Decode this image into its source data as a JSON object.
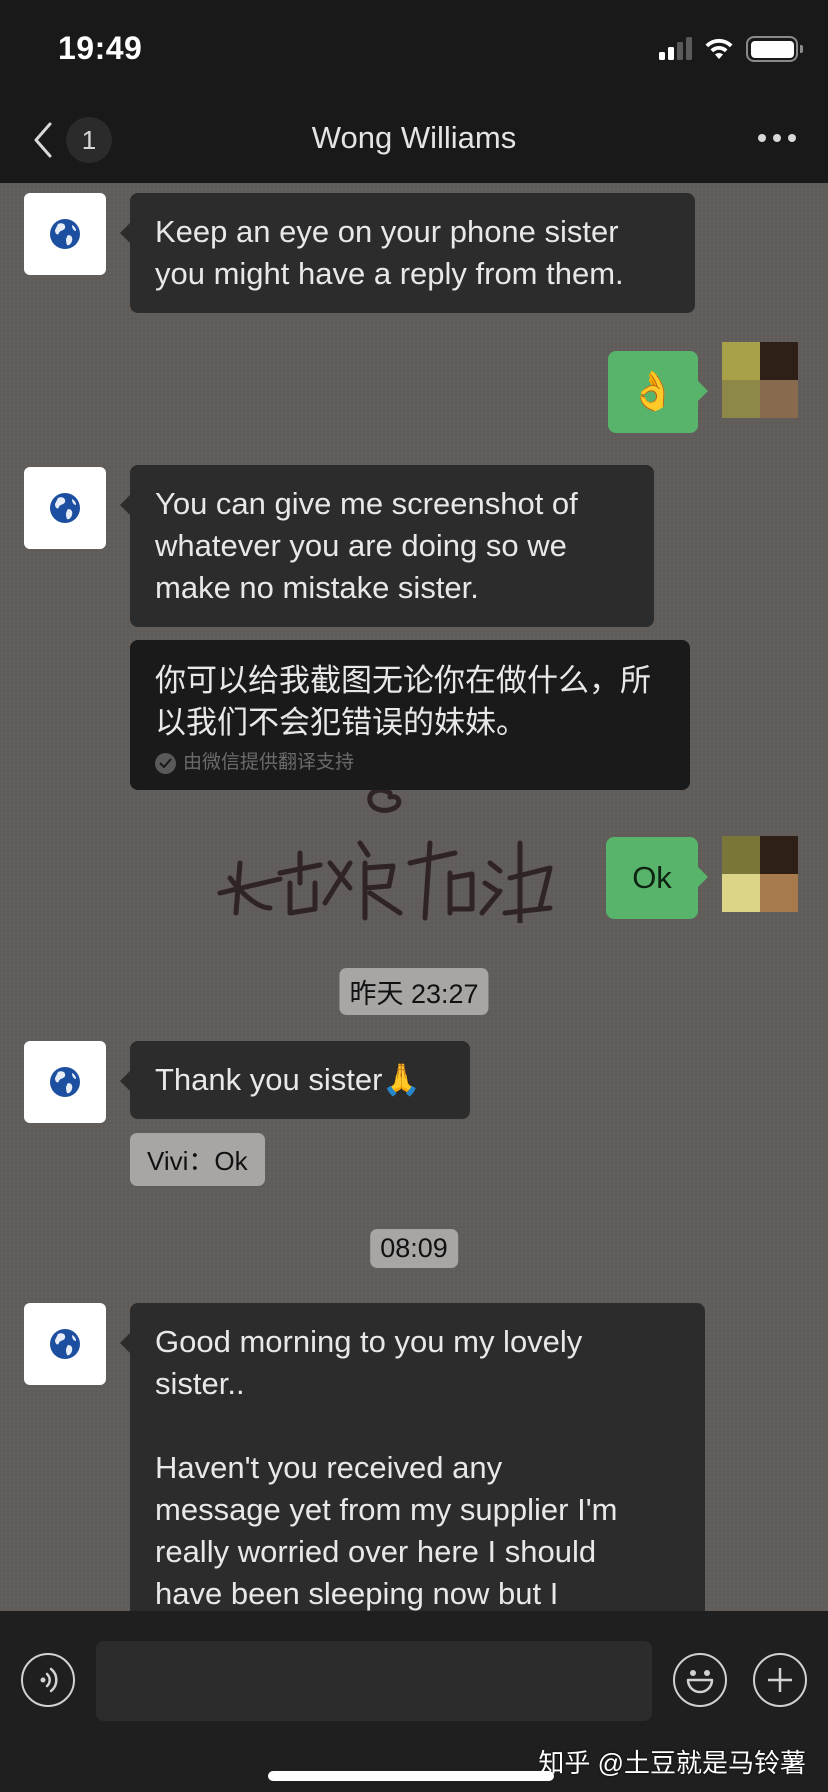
{
  "status_bar": {
    "time": "19:49",
    "icons": [
      "cellular-signal-icon",
      "wifi-icon",
      "battery-icon"
    ]
  },
  "nav": {
    "title": "Wong Williams",
    "unread_count": "1",
    "back_icon": "chevron-left-icon",
    "more_icon": "more-dots-icon"
  },
  "messages": [
    {
      "direction": "incoming",
      "type": "text",
      "avatar_icon": "globe-icon",
      "text": "Keep an eye on your phone sister you might have a reply from them."
    },
    {
      "direction": "outgoing",
      "type": "emoji",
      "text": "👌",
      "avatar_colors": [
        "#a8a148",
        "#2e1f17",
        "#8d8847",
        "#886a4e"
      ]
    },
    {
      "direction": "incoming",
      "type": "text",
      "avatar_icon": "globe-icon",
      "text": "You can give me screenshot of whatever you are doing so we make no mistake sister.",
      "translation": {
        "text": "你可以给我截图无论你在做什么，所以我们不会犯错误的妹妹。",
        "credit": "由微信提供翻译支持"
      }
    },
    {
      "direction": "outgoing",
      "type": "text",
      "text": "Ok",
      "avatar_colors": [
        "#7a7538",
        "#2e1f17",
        "#dcd587",
        "#a77a4e"
      ]
    },
    {
      "type": "timestamp",
      "text": "昨天 23:27"
    },
    {
      "direction": "incoming",
      "type": "text",
      "avatar_icon": "globe-icon",
      "text": "Thank you sister🙏",
      "quote": "Vivi：Ok"
    },
    {
      "type": "timestamp",
      "text": "08:09"
    },
    {
      "direction": "incoming",
      "type": "text",
      "avatar_icon": "globe-icon",
      "text_lines": [
        "Good morning to you my lovely",
        "sister..",
        "",
        "Haven't you received any",
        "message yet from my supplier I'm",
        "really worried over here I should",
        "have been sleeping now but I"
      ]
    }
  ],
  "overlay": {
    "handwriting_text": "姑娘加油"
  },
  "input_bar": {
    "placeholder": "",
    "value": "",
    "voice_icon": "voice-icon",
    "emoji_icon": "emoji-face-icon",
    "plus_icon": "plus-circle-icon"
  },
  "watermark": "知乎 @土豆就是马铃薯",
  "colors": {
    "outgoing_bubble": "#58b46b",
    "incoming_bubble": "#2c2c2c",
    "translation_bubble": "#1a1a1a",
    "chat_background": "#5f5c5a",
    "header_background": "#191919"
  }
}
